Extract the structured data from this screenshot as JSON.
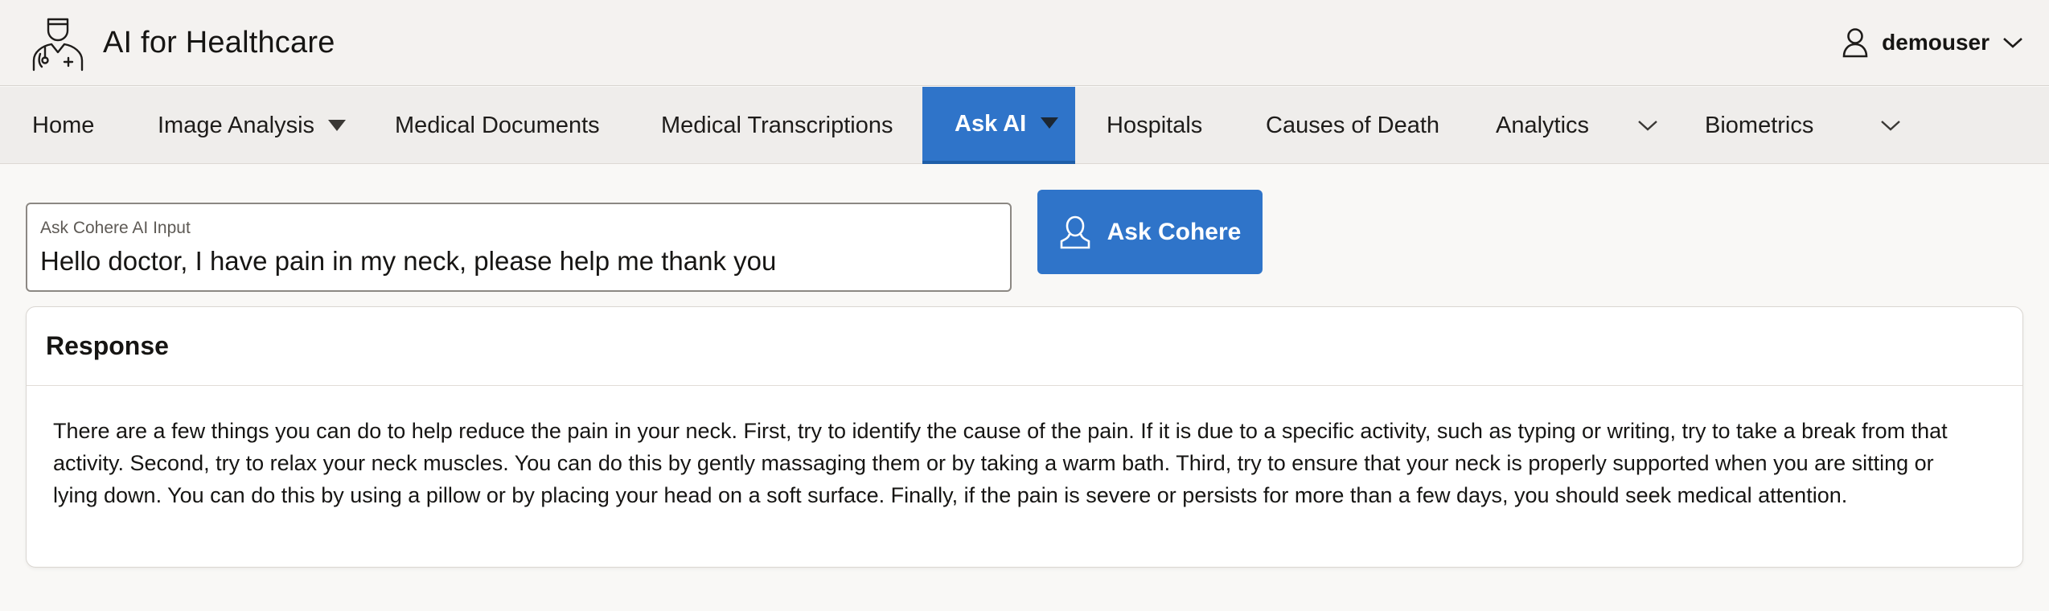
{
  "app": {
    "title": "AI for Healthcare",
    "logo_icon": "doctor-icon"
  },
  "user": {
    "name": "demouser",
    "icon": "user-icon"
  },
  "nav": {
    "items": [
      {
        "label": "Home",
        "has_menu": false,
        "active": false
      },
      {
        "label": "Image Analysis",
        "has_menu": true,
        "active": false
      },
      {
        "label": "Medical Documents",
        "has_menu": false,
        "active": false
      },
      {
        "label": "Medical Transcriptions",
        "has_menu": false,
        "active": false
      },
      {
        "label": "Ask AI",
        "has_menu": true,
        "active": true
      },
      {
        "label": "Hospitals",
        "has_menu": false,
        "active": false
      },
      {
        "label": "Causes of Death",
        "has_menu": false,
        "active": false
      },
      {
        "label": "Analytics",
        "has_menu": true,
        "active": false
      },
      {
        "label": "Biometrics",
        "has_menu": true,
        "active": false
      }
    ]
  },
  "prompt": {
    "label": "Ask Cohere AI Input",
    "value": "Hello doctor, I have pain in my neck, please help me thank you"
  },
  "ask_button": {
    "label": "Ask Cohere",
    "icon": "user-icon"
  },
  "response": {
    "title": "Response",
    "text": "There are a few things you can do to help reduce the pain in your neck. First, try to identify the cause of the pain. If it is due to a specific activity, such as typing or writing, try to take a break from that activity. Second, try to relax your neck muscles. You can do this by gently massaging them or by taking a warm bath. Third, try to ensure that your neck is properly supported when you are sitting or lying down. You can do this by using a pillow or by placing your head on a soft surface. Finally, if the pain is severe or persists for more than a few days, you should seek medical attention."
  },
  "colors": {
    "accent": "#2f74c9",
    "header_bg": "#f4f2f0",
    "nav_bg": "#efedeb",
    "page_bg": "#f9f8f6"
  }
}
